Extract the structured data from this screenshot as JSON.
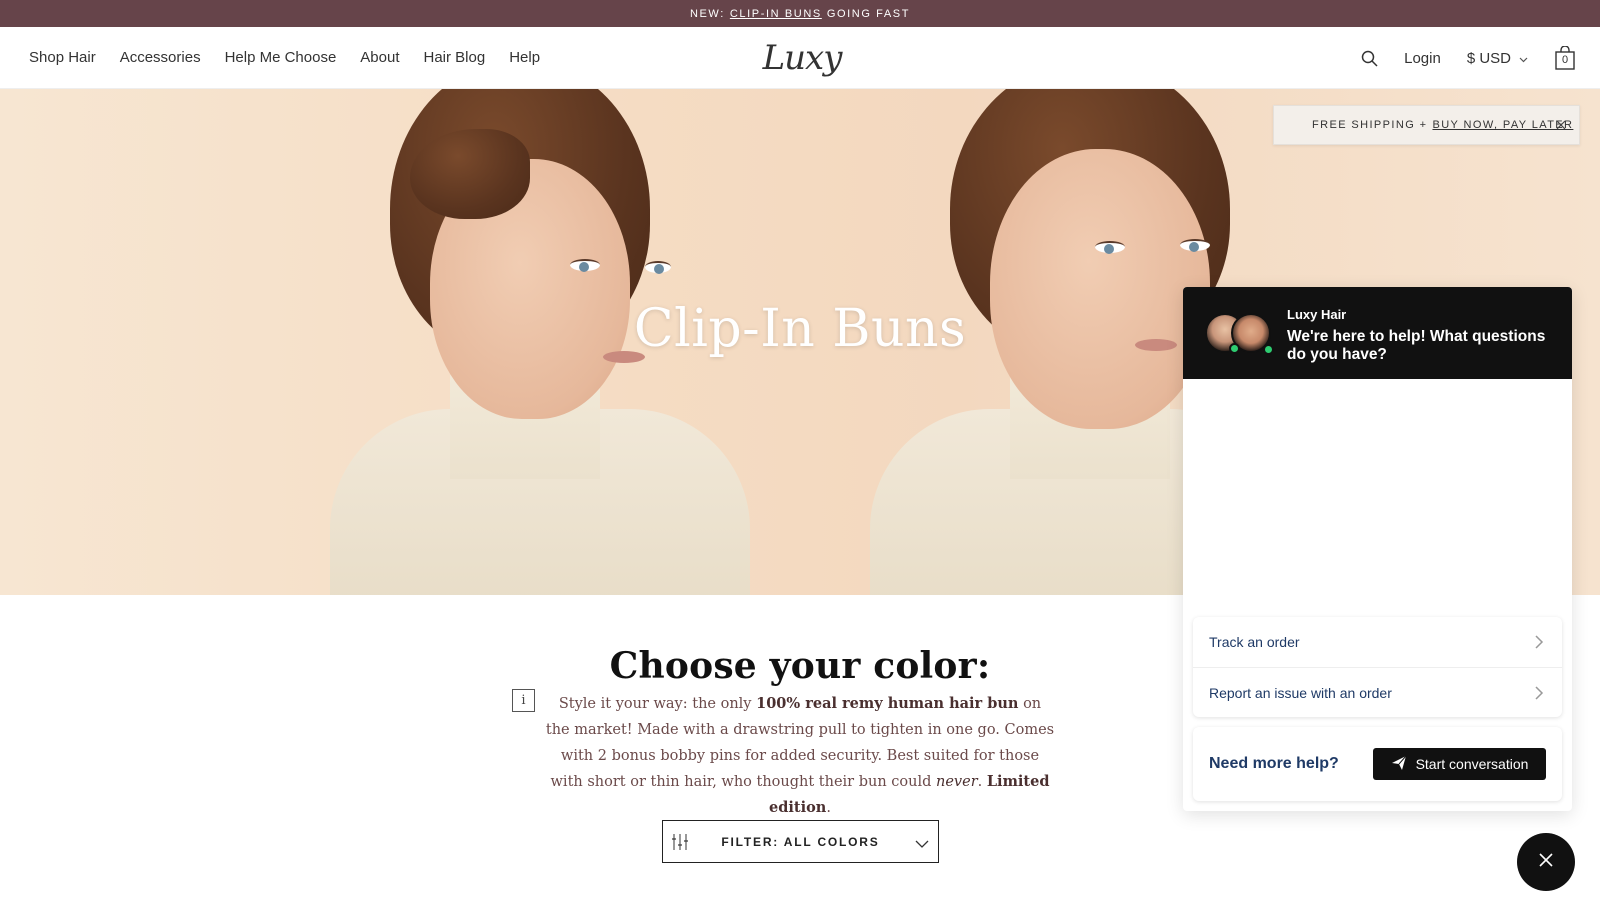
{
  "announcement": {
    "prefix": "NEW:",
    "link": "CLIP-IN BUNS",
    "suffix": "GOING FAST"
  },
  "header": {
    "nav": [
      "Shop Hair",
      "Accessories",
      "Help Me Choose",
      "About",
      "Hair Blog",
      "Help"
    ],
    "logo": "Luxy",
    "login": "Login",
    "currency": "$ USD",
    "cart_count": "0"
  },
  "hero": {
    "title": "Clip-In Buns"
  },
  "toast": {
    "prefix": "FREE SHIPPING +",
    "link": "BUY NOW, PAY LATER"
  },
  "content": {
    "title": "Choose your color:",
    "info_glyph": "i",
    "desc_1": "Style it your way: the only",
    "desc_bold_1": "100% real remy human hair bun",
    "desc_2": "on the market! Made with a drawstring pull to tighten in one go. Comes with 2 bonus bobby pins for added security. Best suited for those with short or thin hair, who thought their bun could",
    "desc_italic": "never",
    "desc_3": ".",
    "desc_bold_2": "Limited edition",
    "desc_4": ".",
    "filter_label": "FILTER: ALL COLORS"
  },
  "chat": {
    "brand": "Luxy Hair",
    "greeting": "We're here to help! What questions do you have?",
    "options": [
      "Track an order",
      "Report an issue with an order"
    ],
    "help_question": "Need more help?",
    "start_button": "Start conversation"
  },
  "colors": {
    "announcement_bg": "#66444a",
    "chat_head_bg": "#111111",
    "chat_text": "#1f3a66",
    "online_dot": "#2ecc71"
  }
}
